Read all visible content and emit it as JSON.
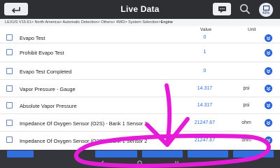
{
  "header": {
    "title": "Live Data",
    "back_icon": "back-arrow-icon",
    "message_icon": "message-icon",
    "search_icon": "search-icon",
    "battery_label": "43%"
  },
  "breadcrumb": {
    "path": "LEXUS V15.61> North America> Automatic Detection> Others> 4WD> System Selection>",
    "current": "Engine"
  },
  "columns": {
    "name": "",
    "value": "Value",
    "unit": "Unit"
  },
  "rows": [
    {
      "name": "Evapo Test",
      "value": "0",
      "unit": ""
    },
    {
      "name": "Prohibit Evapo Test",
      "value": "1",
      "unit": ""
    },
    {
      "name": "Evapo Test Completed",
      "value": "0",
      "unit": ""
    },
    {
      "name": "Vapor Pressure - Gauge",
      "value": "14.317",
      "unit": "psi"
    },
    {
      "name": "Absolute Vapor Pressure",
      "value": "14.317",
      "unit": "psi"
    },
    {
      "name": "Impedance Of Oxygen Sensor (O2S) - Bank 1 Sensor 2",
      "value": "21247.67",
      "unit": "ohm"
    },
    {
      "name": "Impedance Of Oxygen Sensor (O2S) - Bank 1 Sensor 2",
      "value": "21247.67",
      "unit": "ohm"
    }
  ],
  "colors": {
    "header_bg": "#2e2f33",
    "accent_blue": "#2b6bd1",
    "function_button": "#2f6fe0",
    "annotation": "#e51bd8"
  }
}
